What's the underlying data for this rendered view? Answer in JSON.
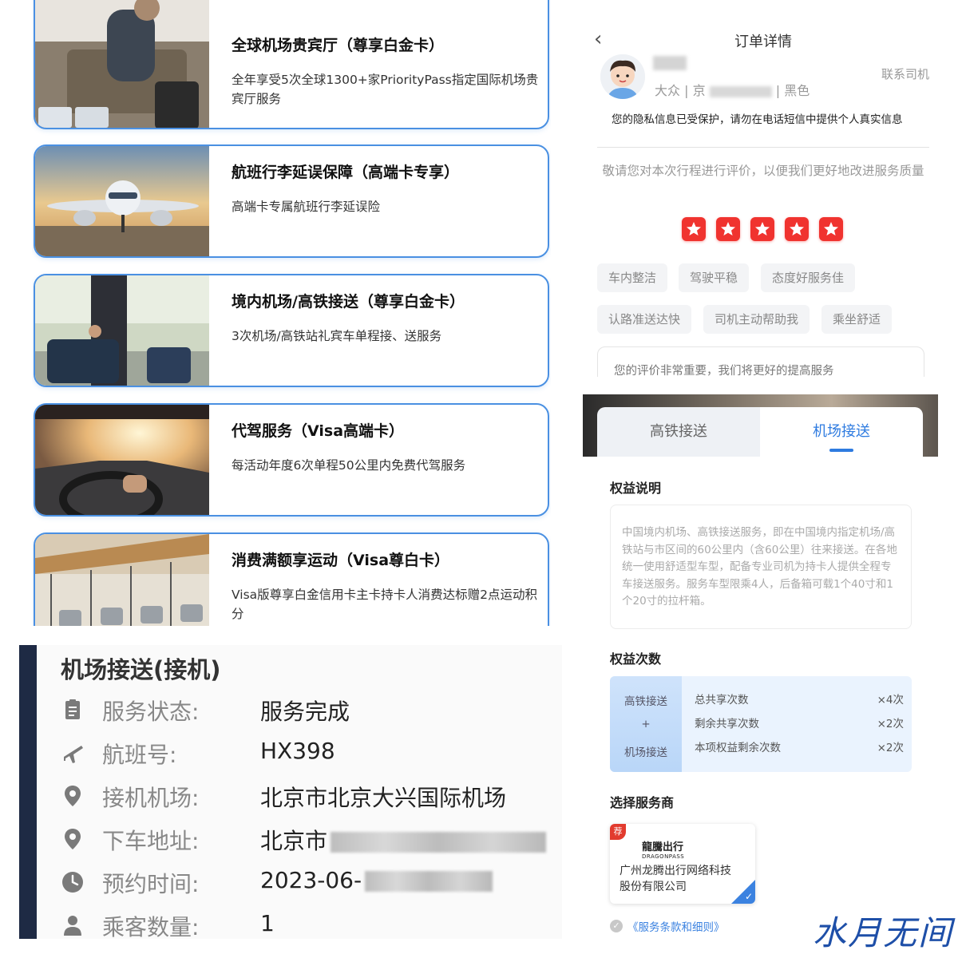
{
  "cards": [
    {
      "title": "全球机场贵宾厅（尊享白金卡）",
      "desc": "全年享受5次全球1300+家PriorityPass指定国际机场贵宾厅服务"
    },
    {
      "title": "航班行李延误保障（高端卡专享）",
      "desc": "高端卡专属航班行李延误险"
    },
    {
      "title": "境内机场/高铁接送（尊享白金卡）",
      "desc": "3次机场/高铁站礼宾车单程接、送服务"
    },
    {
      "title": "代驾服务（Visa高端卡）",
      "desc": "每活动年度6次单程50公里内免费代驾服务"
    },
    {
      "title": "消费满额享运动（Visa尊白卡）",
      "desc": "Visa版尊享白金信用卡主卡持卡人消费达标赠2点运动积分"
    }
  ],
  "order": {
    "back_icon": "‹",
    "title": "订单详情",
    "car_brand": "大众",
    "plate_prefix": "京",
    "car_color": "黑色",
    "contact_driver": "联系司机",
    "privacy_note": "您的隐私信息已受保护，请勿在电话短信中提供个人真实信息",
    "rate_prompt": "敬请您对本次行程进行评价，以便我们更好地改进服务质量",
    "star_count": 5,
    "tags": [
      "车内整洁",
      "驾驶平稳",
      "态度好服务佳",
      "认路准送达快",
      "司机主动帮助我",
      "乘坐舒适"
    ],
    "comment_placeholder": "您的评价非常重要，我们将更好的提高服务"
  },
  "benefit": {
    "tabs": [
      {
        "label": "高铁接送",
        "active": false
      },
      {
        "label": "机场接送",
        "active": true
      }
    ],
    "desc_title": "权益说明",
    "desc_text": "中国境内机场、高铁接送服务，即在中国境内指定机场/高铁站与市区间的60公里内（含60公里）往来接送。在各地统一使用舒适型车型，配备专业司机为持卡人提供全程专车接送服务。服务车型限乘4人，后备箱可载1个40寸和1个20寸的拉杆箱。",
    "count_title": "权益次数",
    "count_left_top": "高铁接送",
    "count_left_plus": "+",
    "count_left_bottom": "机场接送",
    "counts": [
      {
        "label": "总共享次数",
        "value": "×4次"
      },
      {
        "label": "剩余共享次数",
        "value": "×2次"
      },
      {
        "label": "本项权益剩余次数",
        "value": "×2次"
      }
    ],
    "provider_title": "选择服务商",
    "provider_badge": "荐",
    "provider_logo": "龍騰出行",
    "provider_logo_en": "DRAGONPASS",
    "provider_name": "广州龙腾出行网络科技股份有限公司",
    "terms": "《服务条款和细则》"
  },
  "service": {
    "title": "机场接送(接机)",
    "rows": [
      {
        "icon": "clipboard-icon",
        "label": "服务状态:",
        "value": "服务完成"
      },
      {
        "icon": "airplane-icon",
        "label": "航班号:",
        "value": "HX398"
      },
      {
        "icon": "location-pin-icon",
        "label": "接机机场:",
        "value": "北京市北京大兴国际机场"
      },
      {
        "icon": "location-pin-icon",
        "label": "下车地址:",
        "value": "北京市"
      },
      {
        "icon": "clock-icon",
        "label": "预约时间:",
        "value": "2023-06-"
      },
      {
        "icon": "person-icon",
        "label": "乘客数量:",
        "value": "1"
      }
    ]
  },
  "watermark": "水月无间",
  "colors": {
    "accent": "#2e7be0",
    "card_border": "#4a90e2",
    "star_red": "#f0332f",
    "dark_bar": "#1e2a44"
  }
}
